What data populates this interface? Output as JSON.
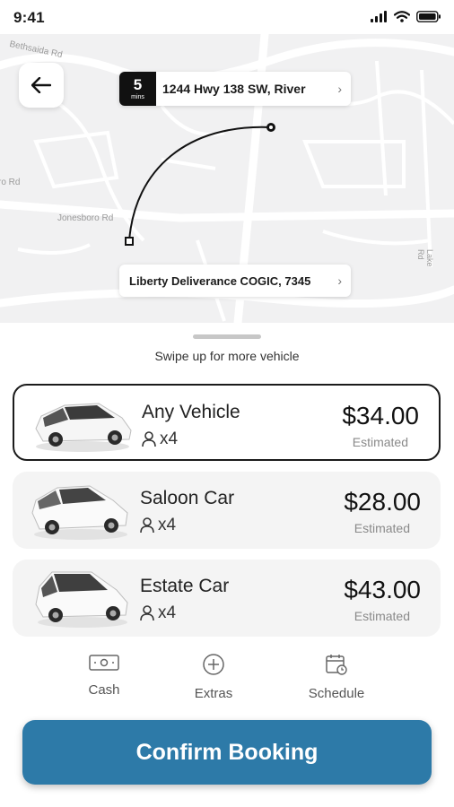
{
  "status": {
    "time": "9:41"
  },
  "map": {
    "road_labels": [
      "Bethsaida Rd",
      "ro Rd",
      "Jonesboro Rd",
      "Lake Rd"
    ],
    "eta": {
      "value": "5",
      "unit": "mins"
    },
    "destination": "1244 Hwy 138 SW, River",
    "origin": "Liberty Deliverance COGIC, 7345"
  },
  "sheet": {
    "swipe_hint": "Swipe up for more vehicle",
    "vehicles": [
      {
        "name": "Any Vehicle",
        "seats": "x4",
        "price": "$34.00",
        "note": "Estimated",
        "selected": true
      },
      {
        "name": "Saloon Car",
        "seats": "x4",
        "price": "$28.00",
        "note": "Estimated",
        "selected": false
      },
      {
        "name": "Estate Car",
        "seats": "x4",
        "price": "$43.00",
        "note": "Estimated",
        "selected": false
      }
    ],
    "options": [
      {
        "label": "Cash",
        "icon": "cash-icon"
      },
      {
        "label": "Extras",
        "icon": "plus-circle-icon"
      },
      {
        "label": "Schedule",
        "icon": "calendar-clock-icon"
      }
    ],
    "confirm_label": "Confirm Booking"
  },
  "colors": {
    "primary": "#2d7aa8",
    "selected_border": "#1b1b1b",
    "card_bg": "#f4f4f4",
    "map_bg": "#f1f1f2"
  }
}
